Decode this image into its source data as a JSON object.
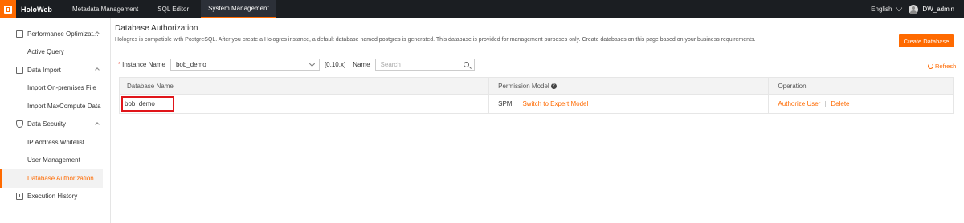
{
  "app": {
    "name": "HoloWeb"
  },
  "nav": {
    "tabs": [
      {
        "label": "Metadata Management"
      },
      {
        "label": "SQL Editor"
      },
      {
        "label": "System Management"
      }
    ]
  },
  "header": {
    "language": "English",
    "user": "DW_admin"
  },
  "sidebar": {
    "groups": [
      {
        "label": "Performance Optimizat...",
        "items": [
          {
            "label": "Active Query"
          }
        ]
      },
      {
        "label": "Data Import",
        "items": [
          {
            "label": "Import On-premises File"
          },
          {
            "label": "Import MaxCompute Data"
          }
        ]
      },
      {
        "label": "Data Security",
        "items": [
          {
            "label": "IP Address Whitelist"
          },
          {
            "label": "User Management"
          },
          {
            "label": "Database Authorization"
          }
        ]
      },
      {
        "label": "Execution History",
        "items": []
      }
    ]
  },
  "page": {
    "title": "Database Authorization",
    "description": "Hologres is compatible with PostgreSQL. After you create a Hologres instance, a default database named postgres is generated. This database is provided for management purposes only. Create databases on this page based on your business requirements.",
    "create_button": "Create Database"
  },
  "filter": {
    "required_mark": "*",
    "instance_label": "Instance Name",
    "instance_value": "bob_demo",
    "version": "[0.10.x]",
    "name_label": "Name",
    "search_placeholder": "Search",
    "refresh_label": "Refresh"
  },
  "table": {
    "headers": {
      "db_name": "Database Name",
      "permission_model": "Permission Model",
      "operation": "Operation"
    },
    "help_glyph": "?",
    "rows": [
      {
        "db_name": "bob_demo",
        "model": "SPM",
        "switch_link": "Switch to Expert Model",
        "authorize": "Authorize User",
        "delete": "Delete"
      }
    ]
  },
  "colors": {
    "accent": "#ff6a00",
    "highlight_box": "#e0151a",
    "topbar": "#1b1e22"
  }
}
